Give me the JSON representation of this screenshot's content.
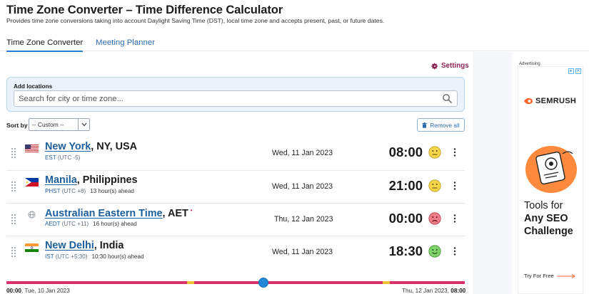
{
  "header": {
    "title": "Time Zone Converter – Time Difference Calculator",
    "subtitle": "Provides time zone conversions taking into account Daylight Saving Time (DST), local time zone and accepts present, past, or future dates."
  },
  "tabs": [
    {
      "label": "Time Zone Converter",
      "active": true
    },
    {
      "label": "Meeting Planner",
      "active": false
    }
  ],
  "settings": {
    "label": "Settings"
  },
  "add_locations": {
    "label": "Add locations",
    "placeholder": "Search for city or time zone..."
  },
  "sort": {
    "label": "Sort by",
    "selected": "-- Custom --"
  },
  "remove_all": {
    "label": "Remove all"
  },
  "locations": [
    {
      "city": "New York",
      "region": ", NY, USA",
      "tz": "EST",
      "offset": "(UTC -5)",
      "diff": "",
      "date": "Wed, 11 Jan 2023",
      "time": "08:00",
      "mood": "neutral",
      "flag": "us"
    },
    {
      "city": "Manila",
      "region": ", Philippines",
      "tz": "PHST",
      "offset": "(UTC +8)",
      "diff": "13 hour(s) ahead",
      "date": "Wed, 11 Jan 2023",
      "time": "21:00",
      "mood": "neutral",
      "flag": "ph"
    },
    {
      "city": "Australian Eastern Time",
      "region": ", AET",
      "tz": "AEDT",
      "offset": "(UTC +11)",
      "diff": "16 hour(s) ahead",
      "date": "Thu, 12 Jan 2023",
      "time": "00:00",
      "mood": "sad",
      "flag": "globe"
    },
    {
      "city": "New Delhi",
      "region": ", India",
      "tz": "IST",
      "offset": "(UTC +5:30)",
      "diff": "10:30 hour(s) ahead",
      "date": "Wed, 11 Jan 2023",
      "time": "18:30",
      "mood": "happy",
      "flag": "in"
    }
  ],
  "timeline": {
    "start_time": "00:00",
    "start_date": ", Tue, 10 Jan 2023",
    "end_date": "Thu, 12 Jan 2023, ",
    "end_time": "08:00",
    "position": 0.56
  },
  "ad": {
    "label": "Advertising",
    "brand": "SEMRUSH",
    "headline_1": "Tools for",
    "headline_2": "Any SEO",
    "headline_3": "Challenge",
    "cta": "Try For Free"
  },
  "colors": {
    "accent": "#2c7bd3",
    "settings": "#8a2252",
    "timeline_bar": "#d9306a",
    "timeline_day": "#f1c232",
    "link": "#1d5f9c"
  }
}
